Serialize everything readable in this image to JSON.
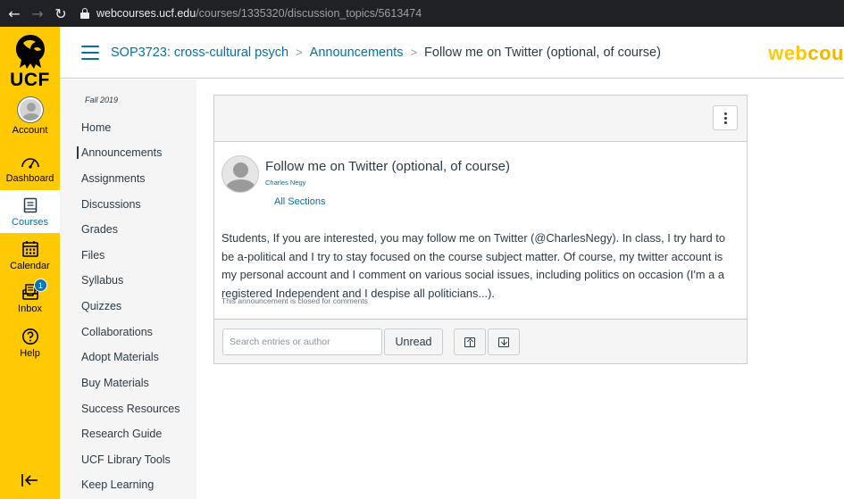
{
  "browser": {
    "url_domain": "webcourses.ucf.edu",
    "url_path": "/courses/1335320/discussion_topics/5613474"
  },
  "global_nav": {
    "logo_text": "UCF",
    "items": [
      {
        "label": "Account",
        "icon": "avatar"
      },
      {
        "label": "Dashboard",
        "icon": "dashboard-icon"
      },
      {
        "label": "Courses",
        "icon": "courses-icon"
      },
      {
        "label": "Calendar",
        "icon": "calendar-icon"
      },
      {
        "label": "Inbox",
        "icon": "inbox-icon",
        "badge": "1"
      },
      {
        "label": "Help",
        "icon": "help-icon"
      }
    ],
    "active_color": "#0770a3",
    "brand_color": "#ffc904"
  },
  "header": {
    "breadcrumbs": [
      "SOP3723: cross-cultural psych",
      "Announcements",
      "Follow me on Twitter (optional, of course)"
    ],
    "brand_web": "web",
    "brand_rest": "cou"
  },
  "course_nav": {
    "term": "Fall 2019",
    "items": [
      "Home",
      "Announcements",
      "Assignments",
      "Discussions",
      "Grades",
      "Files",
      "Syllabus",
      "Quizzes",
      "Collaborations",
      "Adopt Materials",
      "Buy Materials",
      "Success Resources",
      "Research Guide",
      "UCF Library Tools",
      "Keep Learning"
    ],
    "active": "Announcements"
  },
  "announcement": {
    "title": "Follow me on Twitter (optional, of course)",
    "author": "Charles Negy",
    "sections": "All Sections",
    "body": "Students, If you are interested, you may follow me on Twitter (@CharlesNegy).  In class, I try hard to be a-political and I try to stay focused on the course subject matter. Of course, my twitter account is my personal account and I comment on various social issues, including politics on occasion (I'm a a registered Independent and I despise all politicians...).",
    "closed_note": "This announcement is closed for comments"
  },
  "toolbar": {
    "search_placeholder": "Search entries or author",
    "unread_label": "Unread"
  }
}
